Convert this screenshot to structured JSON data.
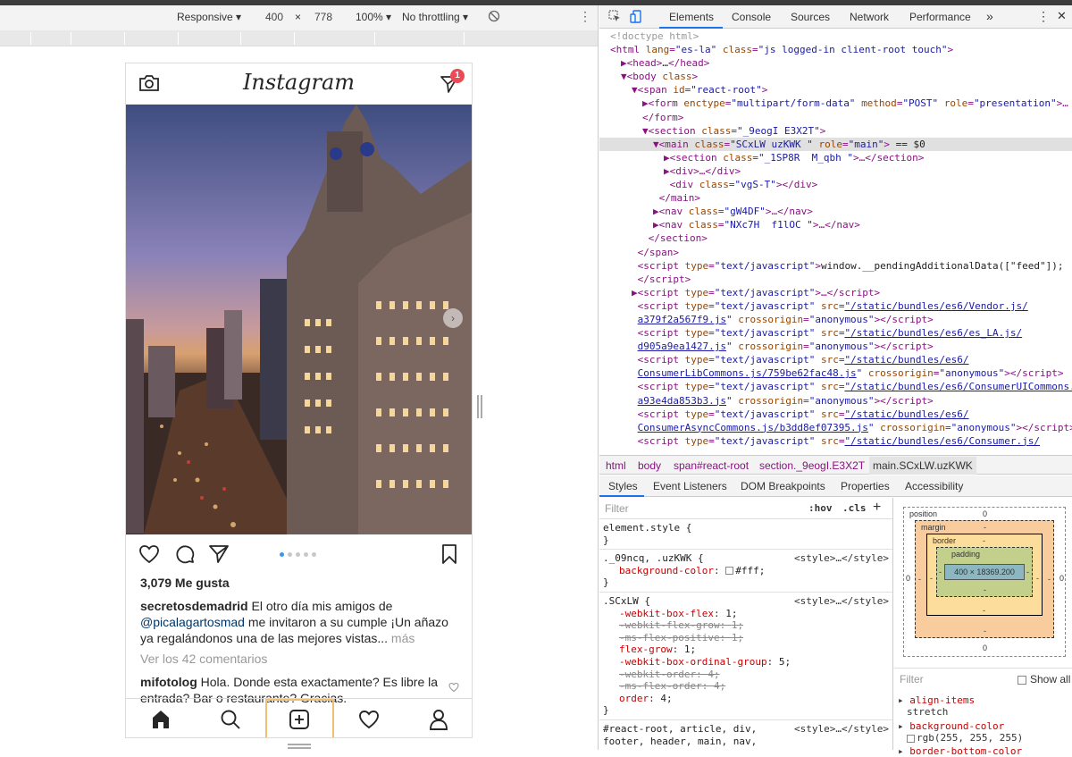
{
  "device_toolbar": {
    "mode": "Responsive ▾",
    "width": "400",
    "times": "×",
    "height": "778",
    "zoom": "100% ▾",
    "throttle": "No throttling ▾"
  },
  "instagram": {
    "logo": "Instagram",
    "dm_badge": "1",
    "likes": "3,079 Me gusta",
    "caption_user": "secretosdemadrid",
    "caption_text_1": " El otro día mis amigos de ",
    "caption_mention": "@picalagartosmad",
    "caption_text_2": " me invitaron a su cumple ¡Un añazo ya regalándonos una de las mejores vistas...",
    "caption_more": " más",
    "view_comments": "Ver los 42 comentarios",
    "comment_user": "mifotolog",
    "comment_text": " Hola. Donde esta exactamente? Es libre la entrada? Bar o restaurante? Gracias.",
    "carousel_dots": 5,
    "active_dot": 0
  },
  "devtools": {
    "tabs": [
      "Elements",
      "Console",
      "Sources",
      "Network",
      "Performance",
      "»"
    ],
    "dom_lines": [
      {
        "indent": 0,
        "html": "<span class='c'>&lt;!doctype html&gt;</span>"
      },
      {
        "indent": 0,
        "html": "<span class='t'>&lt;html </span><span class='a'>lang</span>=<span class='v'>\"es-la\"</span> <span class='a'>class</span>=<span class='v'>\"js logged-in client-root touch\"</span><span class='t'>&gt;</span>"
      },
      {
        "indent": 1,
        "html": "▶<span class='t'>&lt;head&gt;</span><span class='tx'>…</span><span class='t'>&lt;/head&gt;</span>"
      },
      {
        "indent": 1,
        "html": "▼<span class='t'>&lt;body </span><span class='a'>class</span><span class='t'>&gt;</span>"
      },
      {
        "indent": 2,
        "html": "▼<span class='t'>&lt;span </span><span class='a'>id</span>=<span class='v'>\"react-root\"</span><span class='t'>&gt;</span>"
      },
      {
        "indent": 3,
        "html": "▶<span class='t'>&lt;form </span><span class='a'>enctype</span>=<span class='v'>\"multipart/form-data\"</span> <span class='a'>method</span>=<span class='v'>\"POST\"</span> <span class='a'>role</span>=<span class='v'>\"presentation\"</span><span class='t'>&gt;…</span>"
      },
      {
        "indent": 3,
        "html": "<span class='t'>&lt;/form&gt;</span>"
      },
      {
        "indent": 3,
        "html": "▼<span class='t'>&lt;section </span><span class='a'>class</span>=<span class='v'>\"_9eogI E3X2T\"</span><span class='t'>&gt;</span>"
      },
      {
        "indent": 4,
        "html": "▼<span class='t'>&lt;main </span><span class='a'>class</span>=<span class='v'>\"SCxLW uzKWK \"</span> <span class='a'>role</span>=<span class='v'>\"main\"</span><span class='t'>&gt;</span> <span class='tx'>== $0</span>",
        "selected": true
      },
      {
        "indent": 5,
        "html": "▶<span class='t'>&lt;section </span><span class='a'>class</span>=<span class='v'>\"_1SP8R  M_qbh \"</span><span class='t'>&gt;…&lt;/section&gt;</span>"
      },
      {
        "indent": 5,
        "html": "▶<span class='t'>&lt;div&gt;…&lt;/div&gt;</span>"
      },
      {
        "indent": 5,
        "html": " <span class='t'>&lt;div </span><span class='a'>class</span>=<span class='v'>\"vgS-T\"</span><span class='t'>&gt;&lt;/div&gt;</span>"
      },
      {
        "indent": 4,
        "html": " <span class='t'>&lt;/main&gt;</span>"
      },
      {
        "indent": 4,
        "html": "▶<span class='t'>&lt;nav </span><span class='a'>class</span>=<span class='v'>\"gW4DF\"</span><span class='t'>&gt;…&lt;/nav&gt;</span>"
      },
      {
        "indent": 4,
        "html": "▶<span class='t'>&lt;nav </span><span class='a'>class</span>=<span class='v'>\"NXc7H  f1lOC \"</span><span class='t'>&gt;…&lt;/nav&gt;</span>"
      },
      {
        "indent": 3,
        "html": " <span class='t'>&lt;/section&gt;</span>"
      },
      {
        "indent": 2,
        "html": " <span class='t'>&lt;/span&gt;</span>"
      },
      {
        "indent": 2,
        "html": " <span class='t'>&lt;script </span><span class='a'>type</span>=<span class='v'>\"text/javascript\"</span><span class='t'>&gt;</span><span class='tx'>window.__pendingAdditionalData([\"feed\"]);</span>"
      },
      {
        "indent": 2,
        "html": " <span class='t'>&lt;/script&gt;</span>"
      },
      {
        "indent": 2,
        "html": "▶<span class='t'>&lt;script </span><span class='a'>type</span>=<span class='v'>\"text/javascript\"</span><span class='t'>&gt;…&lt;/script&gt;</span>"
      },
      {
        "indent": 2,
        "html": " <span class='t'>&lt;script </span><span class='a'>type</span>=<span class='v'>\"text/javascript\"</span> <span class='a'>src</span>=<span class='lnk'>\"/static/bundles/es6/Vendor.js/</span>"
      },
      {
        "indent": 2,
        "html": " <span class='lnk'>a379f2a567f9.js</span><span class='v'>\"</span> <span class='a'>crossorigin</span>=<span class='v'>\"anonymous\"</span><span class='t'>&gt;&lt;/script&gt;</span>"
      },
      {
        "indent": 2,
        "html": " <span class='t'>&lt;script </span><span class='a'>type</span>=<span class='v'>\"text/javascript\"</span> <span class='a'>src</span>=<span class='lnk'>\"/static/bundles/es6/es_LA.js/</span>"
      },
      {
        "indent": 2,
        "html": " <span class='lnk'>d905a9ea1427.js</span><span class='v'>\"</span> <span class='a'>crossorigin</span>=<span class='v'>\"anonymous\"</span><span class='t'>&gt;&lt;/script&gt;</span>"
      },
      {
        "indent": 2,
        "html": " <span class='t'>&lt;script </span><span class='a'>type</span>=<span class='v'>\"text/javascript\"</span> <span class='a'>src</span>=<span class='lnk'>\"/static/bundles/es6/</span>"
      },
      {
        "indent": 2,
        "html": " <span class='lnk'>ConsumerLibCommons.js/759be62fac48.js</span><span class='v'>\"</span> <span class='a'>crossorigin</span>=<span class='v'>\"anonymous\"</span><span class='t'>&gt;&lt;/script&gt;</span>"
      },
      {
        "indent": 2,
        "html": " <span class='t'>&lt;script </span><span class='a'>type</span>=<span class='v'>\"text/javascript\"</span> <span class='a'>src</span>=<span class='lnk'>\"/static/bundles/es6/ConsumerUICommons.js/</span>"
      },
      {
        "indent": 2,
        "html": " <span class='lnk'>a93e4da853b3.js</span><span class='v'>\"</span> <span class='a'>crossorigin</span>=<span class='v'>\"anonymous\"</span><span class='t'>&gt;&lt;/script&gt;</span>"
      },
      {
        "indent": 2,
        "html": " <span class='t'>&lt;script </span><span class='a'>type</span>=<span class='v'>\"text/javascript\"</span> <span class='a'>src</span>=<span class='lnk'>\"/static/bundles/es6/</span>"
      },
      {
        "indent": 2,
        "html": " <span class='lnk'>ConsumerAsyncCommons.js/b3dd8ef07395.js</span><span class='v'>\"</span> <span class='a'>crossorigin</span>=<span class='v'>\"anonymous\"</span><span class='t'>&gt;&lt;/script&gt;</span>"
      },
      {
        "indent": 2,
        "html": " <span class='t'>&lt;script </span><span class='a'>type</span>=<span class='v'>\"text/javascript\"</span> <span class='a'>src</span>=<span class='lnk'>\"/static/bundles/es6/Consumer.js/</span>"
      }
    ],
    "breadcrumbs": [
      "html",
      "body",
      "span#react-root",
      "section._9eogI.E3X2T",
      "main.SCxLW.uzKWK"
    ],
    "sub_tabs": [
      "Styles",
      "Event Listeners",
      "DOM Breakpoints",
      "Properties",
      "Accessibility"
    ],
    "filter_placeholder": "Filter",
    "hov": ":hov",
    "cls": ".cls",
    "plus": "+",
    "rules": {
      "r1_sel": "element.style {",
      "close": "}",
      "r2_sel": "._09ncq, .uzKWK {",
      "r2_src": "<style>…</style>",
      "r2_p1n": "background-color",
      "r2_p1v": "#fff;",
      "r3_sel": ".SCxLW {",
      "r3_src": "<style>…</style>",
      "r3_props": [
        {
          "n": "-webkit-box-flex",
          "v": "1;",
          "s": false
        },
        {
          "n": "-webkit-flex-grow",
          "v": "1;",
          "s": true
        },
        {
          "n": "-ms-flex-positive",
          "v": "1;",
          "s": true
        },
        {
          "n": "flex-grow",
          "v": "1;",
          "s": false
        },
        {
          "n": "-webkit-box-ordinal-group",
          "v": "5;",
          "s": false
        },
        {
          "n": "-webkit-order",
          "v": "4;",
          "s": true
        },
        {
          "n": "-ms-flex-order",
          "v": "4;",
          "s": true
        },
        {
          "n": "order",
          "v": "4;",
          "s": false
        }
      ],
      "r4_sel": "#react-root, article, div,",
      "r4_sel2": "footer, header, main, nav,",
      "r4_src": "<style>…</style>"
    },
    "box_model": {
      "position": "position",
      "position_val": "0",
      "margin": "margin",
      "border": "border",
      "padding": "padding",
      "content": "400 × 18369.200",
      "dash": "-",
      "zero": "0"
    },
    "computed": {
      "filter": "Filter",
      "show_all": "Show all",
      "p1n": "align-items",
      "p1v": "stretch",
      "p2n": "background-color",
      "p2v": "rgb(255, 255, 255)",
      "p3n": "border-bottom-color"
    }
  }
}
